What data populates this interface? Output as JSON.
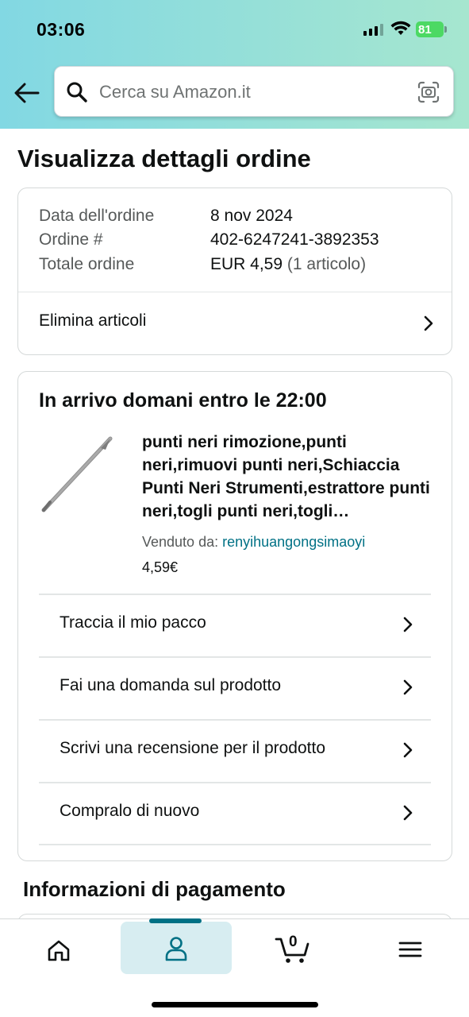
{
  "status_bar": {
    "time": "03:06",
    "battery_level": "81"
  },
  "header": {
    "back_icon": "arrow-left-icon",
    "search": {
      "placeholder": "Cerca su Amazon.it",
      "value": "",
      "search_icon": "search-icon",
      "camera_icon": "camera-scan-icon"
    }
  },
  "page": {
    "title": "Visualizza dettagli ordine"
  },
  "order_summary": {
    "rows": [
      {
        "label": "Data dell'ordine",
        "value": "8 nov 2024"
      },
      {
        "label": "Ordine #",
        "value": "402-6247241-3892353"
      },
      {
        "label": "Totale ordine",
        "value": "EUR 4,59",
        "suffix": "(1 articolo)"
      }
    ],
    "delete_items_label": "Elimina articoli"
  },
  "shipment": {
    "arrival_text": "In arrivo domani entro le 22:00",
    "product": {
      "title": "punti neri rimozione,punti neri,rimuovi punti neri,Schiaccia Punti Neri Strumenti,estrattore punti neri,togli punti neri,togli…",
      "sold_by_label": "Venduto da:",
      "seller": "renyihuangongsimaoyi",
      "price": "4,59€"
    },
    "actions": [
      {
        "label": "Traccia il mio pacco"
      },
      {
        "label": "Fai una domanda sul prodotto"
      },
      {
        "label": "Scrivi una recensione per il prodotto"
      },
      {
        "label": "Compralo di nuovo"
      }
    ]
  },
  "payment": {
    "section_title": "Informazioni di pagamento"
  },
  "bottom_nav": {
    "items": [
      {
        "name": "home",
        "icon": "home-icon"
      },
      {
        "name": "account",
        "icon": "person-icon",
        "active": true
      },
      {
        "name": "cart",
        "icon": "cart-icon",
        "count": "0"
      },
      {
        "name": "menu",
        "icon": "hamburger-menu-icon"
      }
    ]
  },
  "colors": {
    "header_gradient_start": "#82d8e3",
    "header_gradient_end": "#a6e6cf",
    "link": "#007185",
    "active_nav_bg": "#d7edf1",
    "battery": "#4cd964"
  }
}
